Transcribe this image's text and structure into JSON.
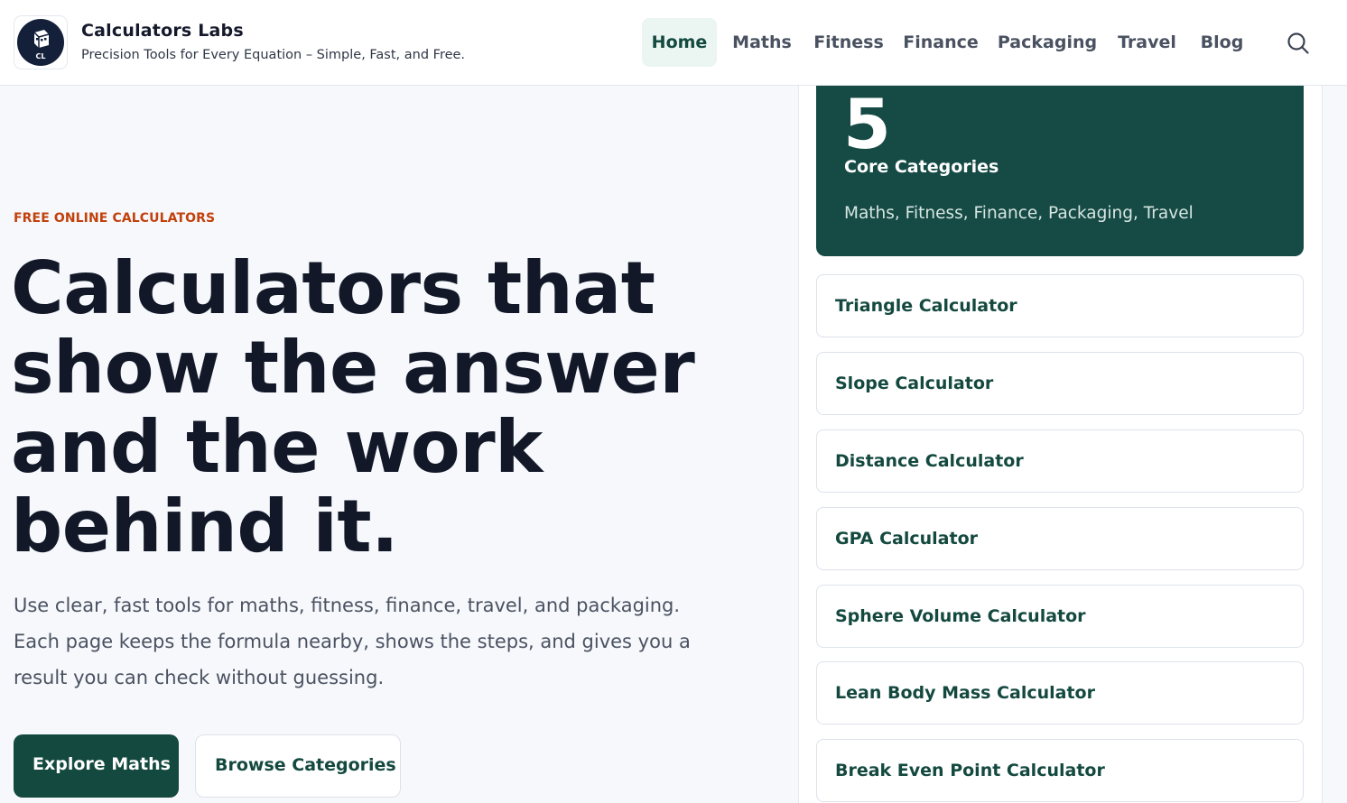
{
  "brand": {
    "logo_text": "CL",
    "name": "Calculators Labs",
    "tagline": "Precision Tools for Every Equation – Simple, Fast, and Free."
  },
  "nav": {
    "items": [
      {
        "label": "Home",
        "active": true
      },
      {
        "label": "Maths"
      },
      {
        "label": "Fitness"
      },
      {
        "label": "Finance"
      },
      {
        "label": "Packaging"
      },
      {
        "label": "Travel"
      },
      {
        "label": "Blog"
      }
    ],
    "search_icon": "search-icon"
  },
  "hero": {
    "eyebrow": "FREE ONLINE CALCULATORS",
    "title_lines": [
      "Calculators that",
      "show the answer",
      "and the work",
      "behind it."
    ],
    "description": "Use clear, fast tools for maths, fitness, finance, travel, and packaging. Each page keeps the formula nearby, shows the steps, and gives you a result you can check without guessing.",
    "primary_button": "Explore Maths",
    "secondary_button": "Browse Categories"
  },
  "stats": {
    "number": "5",
    "label": "Core Categories",
    "list": "Maths, Fitness, Finance, Packaging, Travel"
  },
  "calculators": [
    "Triangle Calculator",
    "Slope Calculator",
    "Distance Calculator",
    "GPA Calculator",
    "Sphere Volume Calculator",
    "Lean Body Mass Calculator",
    "Break Even Point Calculator"
  ],
  "colors": {
    "accent_dark_green": "#14493f",
    "stat_card_bg": "#154a45",
    "eyebrow_orange": "#c2410c",
    "nav_active_bg": "#ebf5f1"
  }
}
